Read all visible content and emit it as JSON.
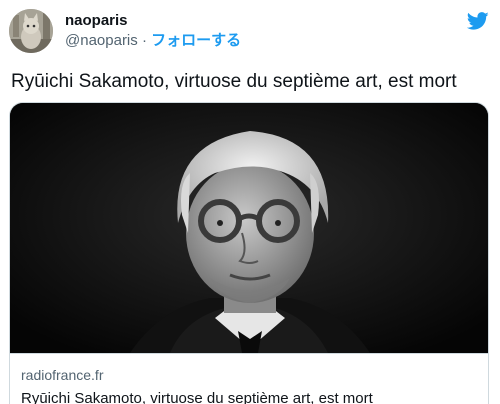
{
  "tweet": {
    "author": {
      "display_name": "naoparis",
      "handle": "@naoparis",
      "separator": " · ",
      "follow_label": "フォローする",
      "avatar_icon": "cat-avatar"
    },
    "brand_icon": "twitter-bird-icon",
    "text": "Ryūichi Sakamoto, virtuose du septième art, est mort",
    "card": {
      "image_description_icon": "portrait-photo",
      "domain": "radiofrance.fr",
      "title": "Ryūichi Sakamoto, virtuose du septième art, est mort"
    }
  },
  "colors": {
    "accent": "#1d9bf0",
    "text": "#0f1419",
    "muted": "#536471",
    "border": "#cfd9de"
  }
}
